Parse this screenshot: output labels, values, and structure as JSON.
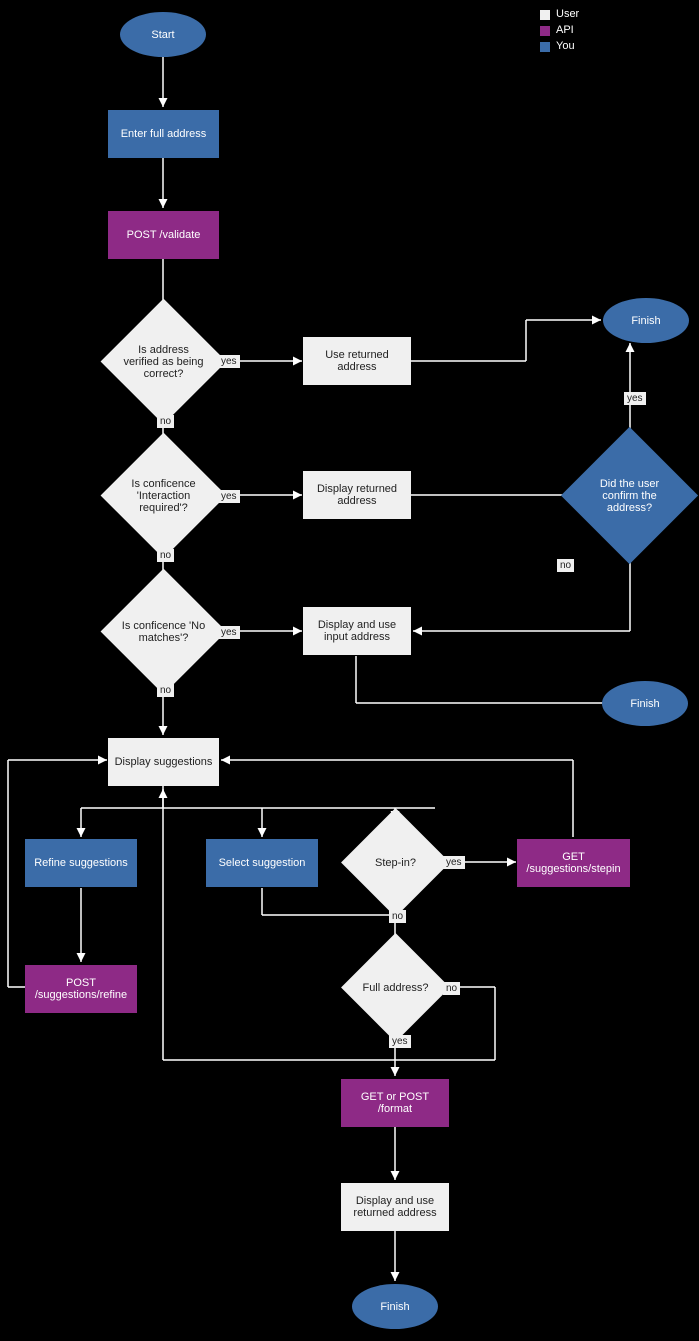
{
  "legend": {
    "user": "User",
    "api": "API",
    "you": "You"
  },
  "term": {
    "start": "Start",
    "finish": "Finish"
  },
  "proc": {
    "enter": "Enter full address",
    "validate": "POST /validate",
    "useReturned": "Use returned address",
    "displayReturned": "Display returned address",
    "displayUseInput": "Display and use input address",
    "displaySuggestions": "Display suggestions",
    "refineSuggestions": "Refine suggestions",
    "selectSuggestion": "Select suggestion",
    "stepinApi": "GET /suggestions/stepin",
    "refineApi": "POST /suggestions/refine",
    "formatApi": "GET or POST /format",
    "displayUseReturned": "Display and use returned address"
  },
  "dec": {
    "verified": "Is address verified as being correct?",
    "interaction": "Is conficence 'Interaction required'?",
    "nomatch": "Is conficence 'No matches'?",
    "confirm": "Did the user confirm the address?",
    "stepin": "Step-in?",
    "fulladdr": "Full address?"
  },
  "lbl": {
    "yes": "yes",
    "no": "no"
  }
}
